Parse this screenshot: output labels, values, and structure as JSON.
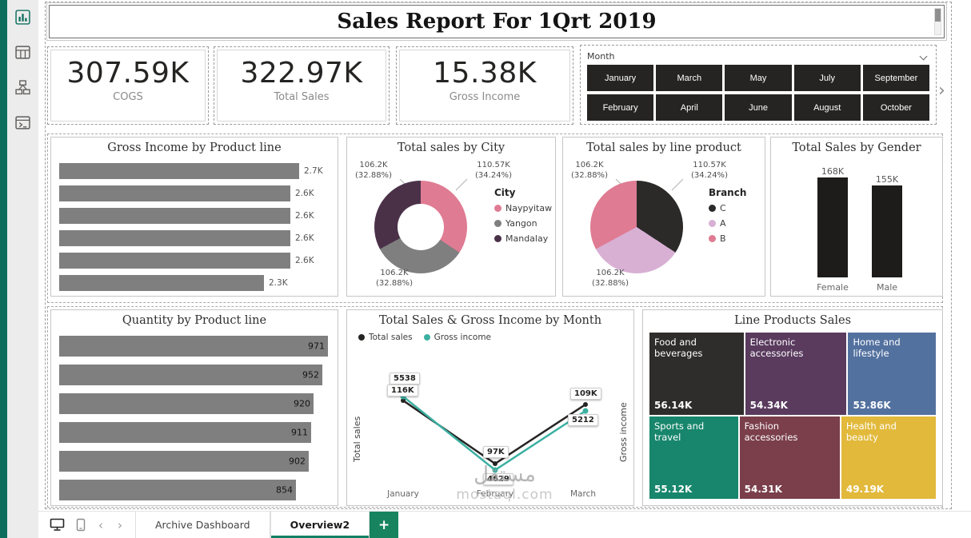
{
  "report": {
    "title": "Sales Report For 1Qrt 2019"
  },
  "sidebar": {
    "icons": [
      "report-view",
      "data-view",
      "model-view",
      "dax-query-view"
    ]
  },
  "kpis": [
    {
      "value": "307.59K",
      "label": "COGS"
    },
    {
      "value": "322.97K",
      "label": "Total Sales"
    },
    {
      "value": "15.38K",
      "label": "Gross Income"
    }
  ],
  "slicer": {
    "title": "Month",
    "row1": [
      "January",
      "March",
      "May",
      "July",
      "September"
    ],
    "row2": [
      "February",
      "April",
      "June",
      "August",
      "October"
    ]
  },
  "chart_data": [
    {
      "id": "gross-income-by-product-line",
      "type": "bar",
      "orientation": "horizontal",
      "title": "Gross Income by Product line",
      "values": [
        2.7,
        2.6,
        2.6,
        2.6,
        2.6,
        2.3
      ],
      "value_labels": [
        "2.7K",
        "2.6K",
        "2.6K",
        "2.6K",
        "2.6K",
        "2.3K"
      ],
      "bar_color": "#7f7f7f"
    },
    {
      "id": "total-sales-by-city",
      "type": "pie",
      "donut": true,
      "title": "Total sales by City",
      "legend_title": "City",
      "legend_position": "right",
      "slices": [
        {
          "name": "Naypyitaw",
          "value": 110.57,
          "value_label": "110.57K",
          "pct": 34.24,
          "pct_label": "(34.24%)",
          "color": "#df7b93"
        },
        {
          "name": "Yangon",
          "value": 106.2,
          "value_label": "106.2K",
          "pct": 32.88,
          "pct_label": "(32.88%)",
          "color": "#7f7f7f"
        },
        {
          "name": "Mandalay",
          "value": 106.2,
          "value_label": "106.2K",
          "pct": 32.88,
          "pct_label": "(32.88%)",
          "color": "#4a3148"
        }
      ]
    },
    {
      "id": "total-sales-by-line-product",
      "type": "pie",
      "donut": false,
      "title": "Total sales by line product",
      "legend_title": "Branch",
      "legend_position": "right",
      "slices": [
        {
          "name": "C",
          "value": 110.57,
          "value_label": "110.57K",
          "pct": 34.24,
          "pct_label": "(34.24%)",
          "color": "#2b2a29"
        },
        {
          "name": "A",
          "value": 106.2,
          "value_label": "106.2K",
          "pct": 32.88,
          "pct_label": "(32.88%)",
          "color": "#d7b0d4"
        },
        {
          "name": "B",
          "value": 106.2,
          "value_label": "106.2K",
          "pct": 32.88,
          "pct_label": "(32.88%)",
          "color": "#df7b93"
        }
      ]
    },
    {
      "id": "total-sales-by-gender",
      "type": "bar",
      "orientation": "vertical",
      "title": "Total Sales by Gender",
      "categories": [
        "Female",
        "Male"
      ],
      "values": [
        168,
        155
      ],
      "value_labels": [
        "168K",
        "155K"
      ],
      "bar_color": "#1d1c1b"
    },
    {
      "id": "quantity-by-product-line",
      "type": "bar",
      "orientation": "horizontal",
      "title": "Quantity by Product line",
      "values": [
        971,
        952,
        920,
        911,
        902,
        854
      ],
      "value_labels": [
        "971",
        "952",
        "920",
        "911",
        "902",
        "854"
      ],
      "bar_color": "#7f7f7f"
    },
    {
      "id": "total-sales-gross-income-by-month",
      "type": "line",
      "title": "Total Sales & Gross Income by Month",
      "x": [
        "January",
        "February",
        "March"
      ],
      "y_axis_left": "Total sales",
      "y_axis_right": "Gross income",
      "series": [
        {
          "name": "Total sales",
          "color": "#252423",
          "values": [
            116000,
            97000,
            109000
          ],
          "value_labels": [
            "116K",
            "97K",
            "109K"
          ]
        },
        {
          "name": "Gross income",
          "color": "#3bb0a1",
          "values": [
            5538,
            4629,
            5212
          ],
          "value_labels": [
            "5538",
            "4629",
            "5212"
          ]
        }
      ]
    },
    {
      "id": "line-products-sales",
      "type": "treemap",
      "title": "Line Products Sales",
      "tiles": [
        {
          "name": "Food and beverages",
          "value": 56.14,
          "value_label": "56.14K",
          "color": "#2e2d2c"
        },
        {
          "name": "Electronic accessories",
          "value": 54.34,
          "value_label": "54.34K",
          "color": "#5a3b5e"
        },
        {
          "name": "Home and lifestyle",
          "value": 53.86,
          "value_label": "53.86K",
          "color": "#53719f"
        },
        {
          "name": "Sports and travel",
          "value": 55.12,
          "value_label": "55.12K",
          "color": "#17866c"
        },
        {
          "name": "Fashion accessories",
          "value": 54.31,
          "value_label": "54.31K",
          "color": "#7a3f4b"
        },
        {
          "name": "Health and beauty",
          "value": 49.19,
          "value_label": "49.19K",
          "color": "#e2b93b"
        }
      ]
    }
  ],
  "footer": {
    "tabs": [
      {
        "label": "Archive Dashboard",
        "active": false
      },
      {
        "label": "Overview2",
        "active": true
      }
    ],
    "add_page_label": "+"
  },
  "watermark": {
    "arabic": "مستقل",
    "latin": "mostaql.com"
  }
}
